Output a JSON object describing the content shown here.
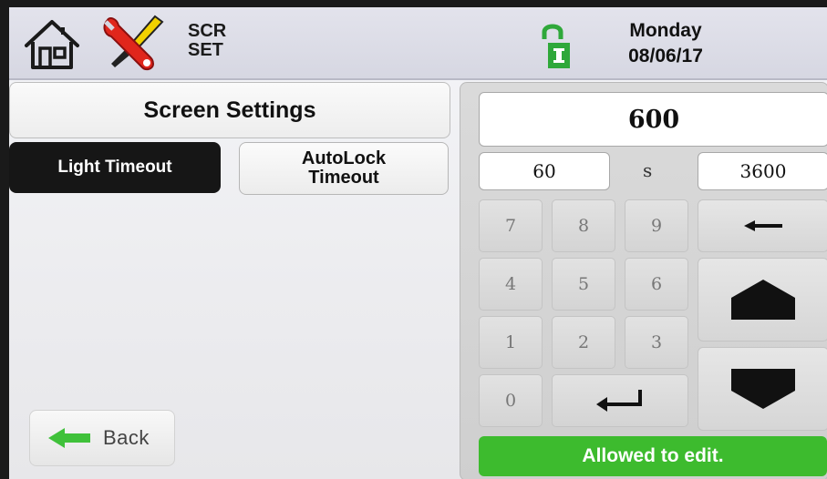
{
  "header": {
    "scr_line1": "SCR",
    "scr_line2": "SET",
    "day": "Monday",
    "date": "08/06/17",
    "icons": [
      "home-icon",
      "tools-icon",
      "unlock-icon"
    ],
    "lock_color": "#2fa83a"
  },
  "left": {
    "title": "Screen Settings",
    "tabs": [
      {
        "label": "Light Timeout",
        "selected": true
      },
      {
        "label": "AutoLock Timeout",
        "selected": false
      }
    ],
    "back_label": "Back",
    "back_icon": "green-left-arrow-icon"
  },
  "keypad": {
    "value": "600",
    "min": "60",
    "unit": "s",
    "max": "3600",
    "keys": [
      "7",
      "8",
      "9",
      "4",
      "5",
      "6",
      "1",
      "2",
      "3",
      "0"
    ],
    "backspace_icon": "backspace-arrow-icon",
    "enter_icon": "enter-icon",
    "up_icon": "up-arrow-icon",
    "down_icon": "down-arrow-icon",
    "status": "Allowed to edit.",
    "status_color": "#3dbb2e"
  }
}
